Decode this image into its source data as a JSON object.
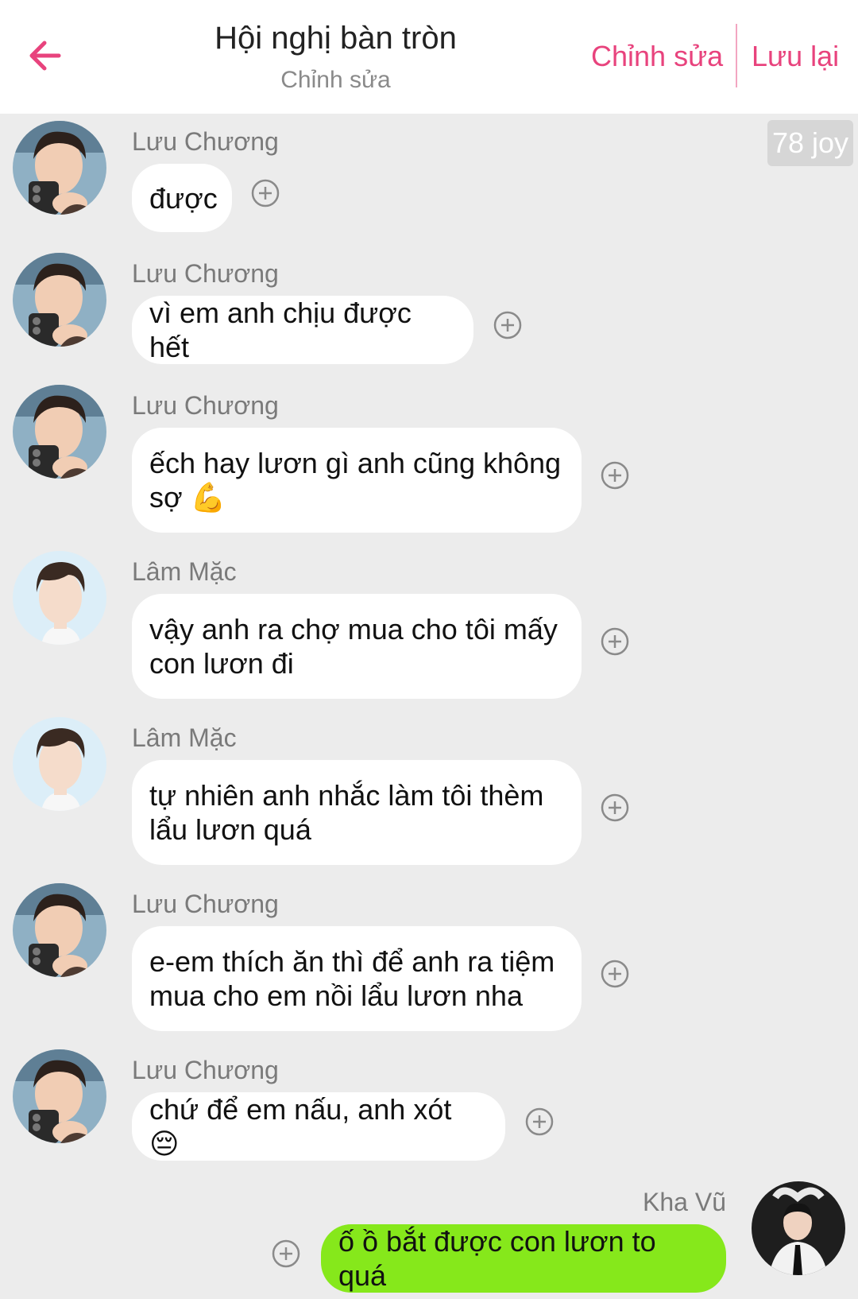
{
  "header": {
    "title": "Hội nghị bàn tròn",
    "subtitle": "Chỉnh sửa",
    "edit_label": "Chỉnh sửa",
    "save_label": "Lưu lại"
  },
  "badge": {
    "label": "78 joy"
  },
  "messages": [
    {
      "sender": "Lưu Chương",
      "text": "được"
    },
    {
      "sender": "Lưu Chương",
      "text": "vì em anh chịu được hết"
    },
    {
      "sender": "Lưu Chương",
      "text": "ếch hay lươn gì anh cũng không sợ 💪"
    },
    {
      "sender": "Lâm Mặc",
      "text": "vậy anh ra chợ mua cho tôi mấy con lươn đi"
    },
    {
      "sender": "Lâm Mặc",
      "text": "tự nhiên anh nhắc làm tôi thèm lẩu lươn quá"
    },
    {
      "sender": "Lưu Chương",
      "text": "e-em thích ăn thì để anh ra tiệm mua cho em nồi lẩu lươn nha"
    },
    {
      "sender": "Lưu Chương",
      "text": "chứ để em nấu, anh xót 😔"
    },
    {
      "sender": "Kha Vũ",
      "text": "ố ồ bắt được con lươn to quá"
    }
  ],
  "colors": {
    "accent": "#e8437d",
    "background": "#ececec",
    "incoming_bubble": "#ffffff",
    "outgoing_bubble": "#86e81b"
  }
}
